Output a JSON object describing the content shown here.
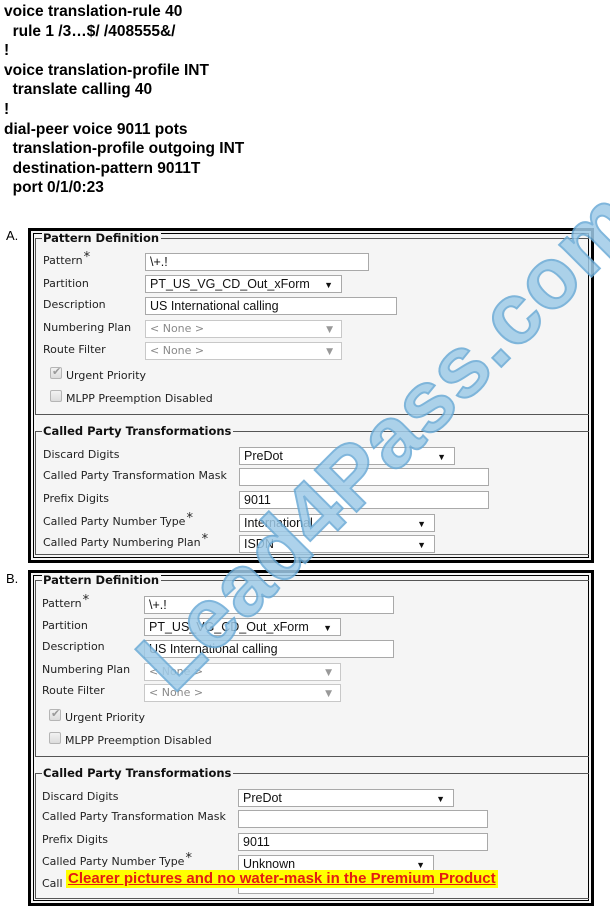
{
  "cli_config": {
    "lines": [
      "voice translation-rule 40",
      "  rule 1 /3…$/ /408555&/",
      "!",
      "voice translation-profile INT",
      "  translate calling 40",
      "!",
      "dial-peer voice 9011 pots",
      "  translation-profile outgoing INT",
      "  destination-pattern 9011T",
      "  port 0/1/0:23"
    ]
  },
  "options": [
    {
      "letter": "A.",
      "pattern_definition": {
        "legend": "Pattern Definition",
        "pattern_label": "Pattern",
        "pattern_value": "\\+.!",
        "partition_label": "Partition",
        "partition_value": "PT_US_VG_CD_Out_xForm",
        "description_label": "Description",
        "description_value": "US International calling",
        "numbering_plan_label": "Numbering Plan",
        "numbering_plan_value": "< None >",
        "route_filter_label": "Route Filter",
        "route_filter_value": "< None >",
        "urgent_priority_label": "Urgent Priority",
        "urgent_priority_checked": true,
        "mlpp_label": "MLPP Preemption Disabled",
        "mlpp_checked": false
      },
      "called_party": {
        "legend": "Called Party Transformations",
        "discard_label": "Discard Digits",
        "discard_value": "PreDot",
        "mask_label": "Called Party Transformation Mask",
        "mask_value": "",
        "prefix_label": "Prefix Digits",
        "prefix_value": "9011",
        "number_type_label": "Called Party Number Type",
        "number_type_value": "International",
        "numbering_plan_label": "Called Party Numbering Plan",
        "numbering_plan_value": "ISDN"
      }
    },
    {
      "letter": "B.",
      "pattern_definition": {
        "legend": "Pattern Definition",
        "pattern_label": "Pattern",
        "pattern_value": "\\+.!",
        "partition_label": "Partition",
        "partition_value": "PT_US_VG_CD_Out_xForm",
        "description_label": "Description",
        "description_value": "US International calling",
        "numbering_plan_label": "Numbering Plan",
        "numbering_plan_value": "< None >",
        "route_filter_label": "Route Filter",
        "route_filter_value": "< None >",
        "urgent_priority_label": "Urgent Priority",
        "urgent_priority_checked": true,
        "mlpp_label": "MLPP Preemption Disabled",
        "mlpp_checked": false
      },
      "called_party": {
        "legend": "Called Party Transformations",
        "discard_label": "Discard Digits",
        "discard_value": "PreDot",
        "mask_label": "Called Party Transformation Mask",
        "mask_value": "",
        "prefix_label": "Prefix Digits",
        "prefix_value": "9011",
        "number_type_label": "Called Party Number Type",
        "number_type_value": "Unknown",
        "numbering_plan_label_partial": "Call",
        "numbering_plan_value": ""
      }
    }
  ],
  "required_marker": "*",
  "checkmark_glyph": "✔",
  "caret_glyph": "▼",
  "watermark": "Lead4Pass.com",
  "promo_banner": "Clearer pictures and no water-mask in the Premium Product",
  "colors": {
    "watermark_fill": "#9fcbe8",
    "promo_bg": "#ffff00",
    "promo_text": "#e41b13",
    "panel_bg": "#f5f5f5"
  }
}
